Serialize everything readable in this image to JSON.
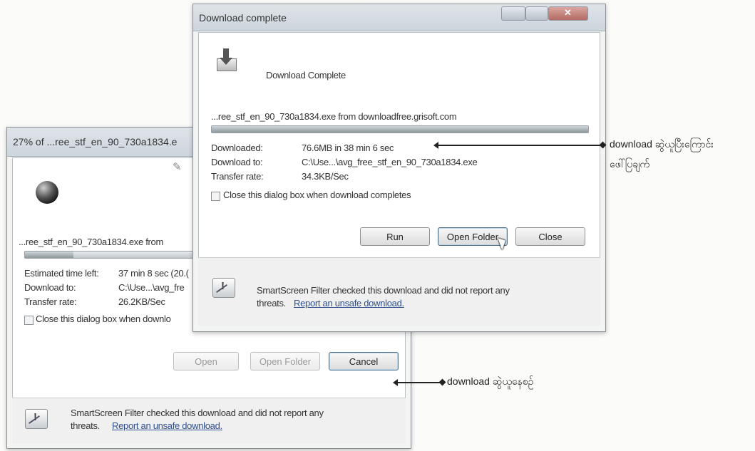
{
  "back_dialog": {
    "title": "27% of ...ree_stf_en_90_730a1834.e",
    "filename": "...ree_stf_en_90_730a1834.exe from",
    "progress": 0.27,
    "estimated_label": "Estimated time left:",
    "estimated_value": "37 min 8 sec (20.(",
    "download_to_label": "Download to:",
    "download_to_value": "C:\\Use...\\avg_fre",
    "transfer_label": "Transfer rate:",
    "transfer_value": "26.2KB/Sec",
    "checkbox_label": "Close this dialog box when downlo",
    "buttons": {
      "open": "Open",
      "open_folder": "Open Folder",
      "cancel": "Cancel"
    },
    "smartscreen_text": "SmartScreen Filter checked this download and did not report any",
    "smartscreen_threats": "threats.",
    "smartscreen_link": "Report an unsafe download."
  },
  "front_dialog": {
    "title": "Download complete",
    "heading": "Download Complete",
    "filename": "...ree_stf_en_90_730a1834.exe from downloadfree.grisoft.com",
    "progress": 1.0,
    "downloaded_label": "Downloaded:",
    "downloaded_value": "76.6MB in 38 min 6 sec",
    "download_to_label": "Download to:",
    "download_to_value": "C:\\Use...\\avg_free_stf_en_90_730a1834.exe",
    "transfer_label": "Transfer rate:",
    "transfer_value": "34.3KB/Sec",
    "checkbox_label": "Close this dialog box when download completes",
    "buttons": {
      "run": "Run",
      "open_folder": "Open Folder",
      "close": "Close"
    },
    "smartscreen_text": "SmartScreen Filter checked this download and did not report any",
    "smartscreen_threats": "threats.",
    "smartscreen_link": "Report an unsafe download."
  },
  "annotations": {
    "complete_line1": "download ဆွဲယူပြီးကြောင်း",
    "complete_line2": "ဖေါ်ပြချက်",
    "downloading": "download ဆွဲယူနေစဉ်"
  },
  "colors": {
    "link": "#2f4f8f",
    "dialog_bg": "#f3f4f4",
    "titlebar": "#d4dbe2"
  }
}
